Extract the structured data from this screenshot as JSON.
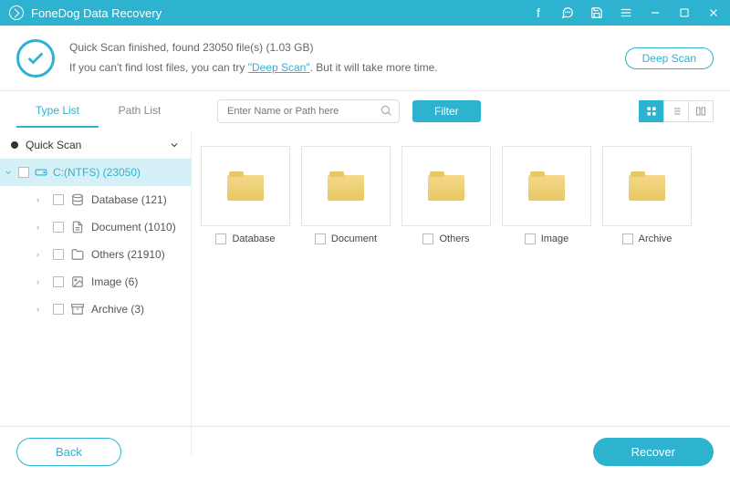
{
  "app": {
    "title": "FoneDog Data Recovery"
  },
  "scan": {
    "line1": "Quick Scan finished, found 23050 file(s) (1.03 GB)",
    "line2a": "If you can't find lost files, you can try ",
    "deep_link": "\"Deep Scan\"",
    "line2b": ". But it will take more time.",
    "deep_button": "Deep Scan"
  },
  "tabs": {
    "type": "Type List",
    "path": "Path List"
  },
  "search": {
    "placeholder": "Enter Name or Path here"
  },
  "filter_button": "Filter",
  "sidebar": {
    "group": "Quick Scan",
    "drive": "C:(NTFS) (23050)",
    "items": [
      {
        "label": "Database (121)"
      },
      {
        "label": "Document (1010)"
      },
      {
        "label": "Others (21910)"
      },
      {
        "label": "Image (6)"
      },
      {
        "label": "Archive (3)"
      }
    ]
  },
  "folders": [
    {
      "label": "Database"
    },
    {
      "label": "Document"
    },
    {
      "label": "Others"
    },
    {
      "label": "Image"
    },
    {
      "label": "Archive"
    }
  ],
  "footer": {
    "back": "Back",
    "recover": "Recover"
  }
}
